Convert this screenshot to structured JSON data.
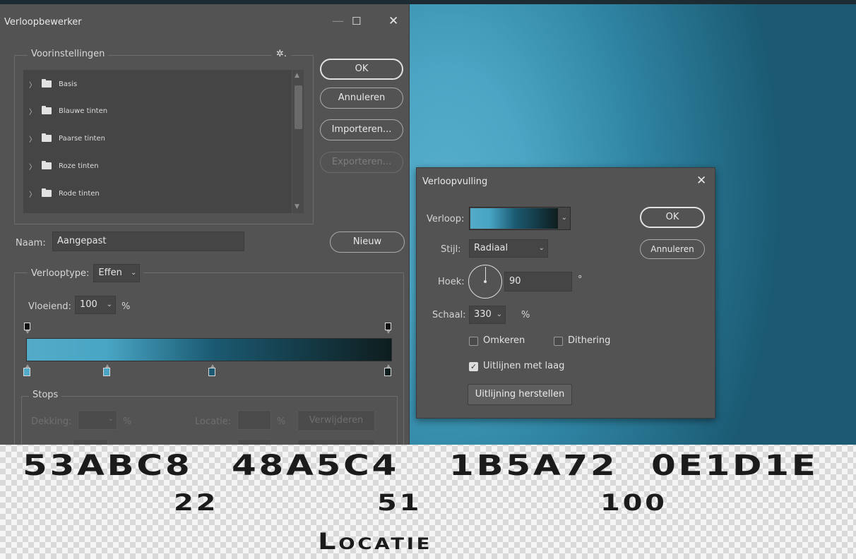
{
  "colors": {
    "stop1": "#53ABC8",
    "stop2": "#48A5C4",
    "stop3": "#1B5A72",
    "stop4": "#0E1D1E",
    "dialog_bg": "#535353"
  },
  "editor": {
    "title": "Verloopbewerker",
    "presets": {
      "legend": "Voorinstellingen",
      "items": [
        "Basis",
        "Blauwe tinten",
        "Paarse tinten",
        "Roze tinten",
        "Rode tinten"
      ]
    },
    "buttons": {
      "ok": "OK",
      "cancel": "Annuleren",
      "import": "Importeren...",
      "export": "Exporteren...",
      "new": "Nieuw"
    },
    "name_label": "Naam:",
    "name_value": "Aangepast",
    "gradient_type_label": "Verlooptype:",
    "gradient_type_value": "Effen",
    "smoothness_label": "Vloeiend:",
    "smoothness_value": "100",
    "percent": "%",
    "stops": {
      "legend": "Stops",
      "opacity_label": "Dekking:",
      "location_label": "Locatie:",
      "delete_label": "Verwijderen",
      "color_stop_locations": [
        0,
        22,
        51,
        100
      ]
    }
  },
  "fill": {
    "title": "Verloopvulling",
    "gradient_label": "Verloop:",
    "style_label": "Stijl:",
    "style_value": "Radiaal",
    "angle_label": "Hoek:",
    "angle_value": "90",
    "degree": "°",
    "scale_label": "Schaal:",
    "scale_value": "330",
    "percent": "%",
    "reverse_label": "Omkeren",
    "reverse_checked": false,
    "dither_label": "Dithering",
    "dither_checked": false,
    "align_label": "Uitlijnen met laag",
    "align_checked": true,
    "reset_align_label": "Uitlijning herstellen",
    "ok": "OK",
    "cancel": "Annuleren"
  },
  "annotation": {
    "colors": [
      "53ABC8",
      "48A5C4",
      "1B5A72",
      "0E1D1E"
    ],
    "locations": [
      "22",
      "51",
      "100"
    ],
    "caption": "Locatie"
  }
}
